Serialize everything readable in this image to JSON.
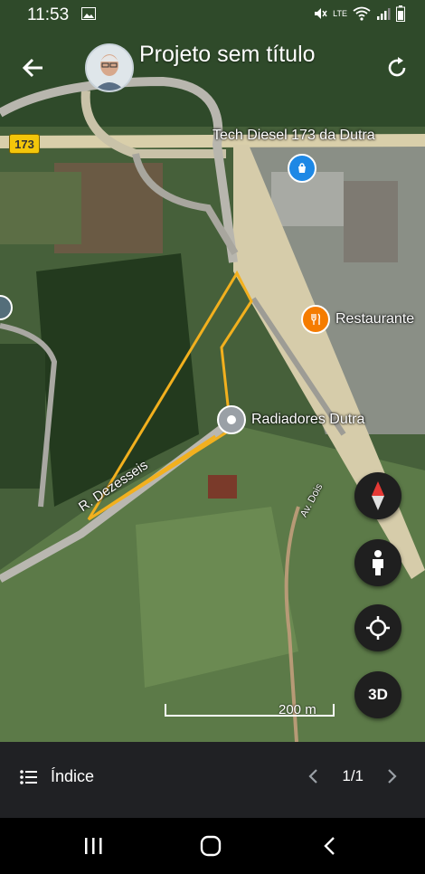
{
  "status": {
    "time": "11:53",
    "network": "LTE",
    "volte": "VoLTE"
  },
  "header": {
    "title": "Projeto sem título"
  },
  "map": {
    "highway_badge": "173",
    "labels": {
      "tech_diesel": "Tech Diesel 173 da Dutra",
      "restaurante": "Restaurante",
      "radiadores": "Radiadores Dutra",
      "street": "R. Dezesseis",
      "av_dois": "Av. Dois"
    },
    "scale": "200 m",
    "controls": {
      "three_d": "3D"
    }
  },
  "bottom": {
    "index_label": "Índice",
    "page": "1/1"
  },
  "colors": {
    "polygon": "#f2b01e",
    "restaurant_pin": "#f57c00",
    "shop_pin": "#1e88e5"
  }
}
